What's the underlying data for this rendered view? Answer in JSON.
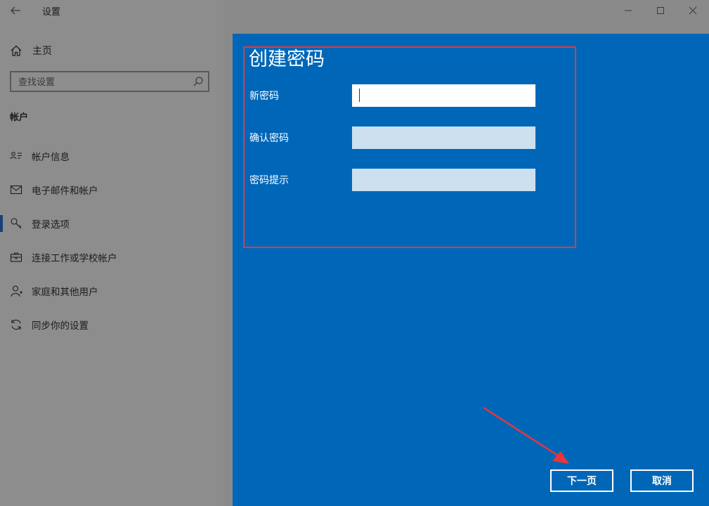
{
  "window": {
    "title": "设置"
  },
  "sidebar": {
    "home_label": "主页",
    "search_placeholder": "查找设置",
    "section_title": "帐户",
    "items": [
      {
        "label": "帐户信息",
        "icon": "contact-card-icon",
        "active": false
      },
      {
        "label": "电子邮件和帐户",
        "icon": "mail-icon",
        "active": false
      },
      {
        "label": "登录选项",
        "icon": "key-icon",
        "active": true
      },
      {
        "label": "连接工作或学校帐户",
        "icon": "briefcase-icon",
        "active": false
      },
      {
        "label": "家庭和其他用户",
        "icon": "person-icon",
        "active": false
      },
      {
        "label": "同步你的设置",
        "icon": "sync-icon",
        "active": false
      }
    ]
  },
  "dialog": {
    "title": "创建密码",
    "fields": [
      {
        "label": "新密码",
        "value": ""
      },
      {
        "label": "确认密码",
        "value": ""
      },
      {
        "label": "密码提示",
        "value": ""
      }
    ],
    "next_label": "下一页",
    "cancel_label": "取消"
  },
  "colors": {
    "dialog_bg": "#0067b8",
    "annotation_red": "#e8363a",
    "sidebar_active_bar": "#1a3f7a"
  }
}
